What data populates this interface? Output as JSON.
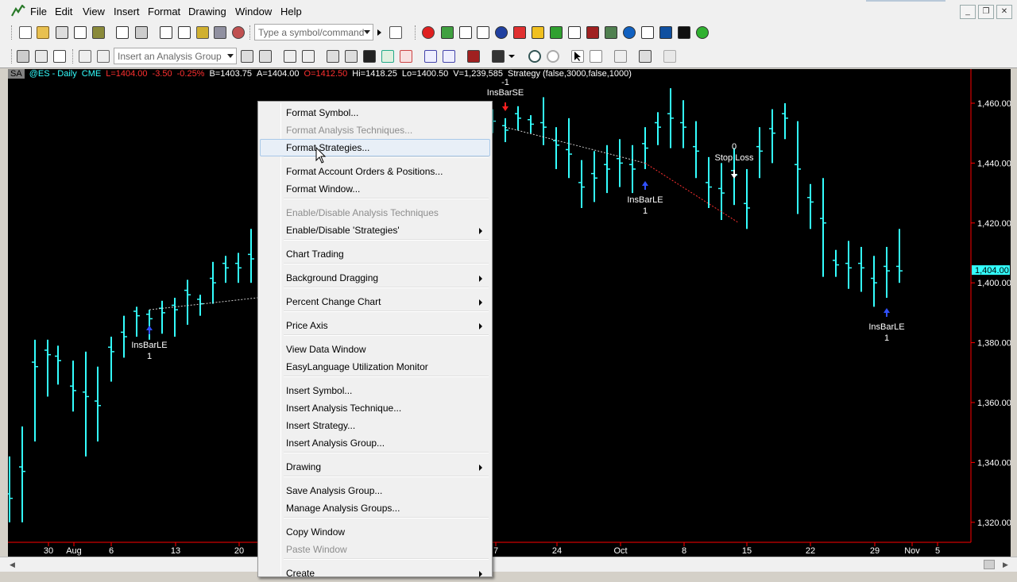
{
  "menubar": {
    "items": [
      "File",
      "Edit",
      "View",
      "Insert",
      "Format",
      "Drawing",
      "Window",
      "Help"
    ],
    "window_controls": [
      "_",
      "❐",
      "✕"
    ]
  },
  "toolbar1": {
    "symbol_combo_placeholder": "Type a symbol/command"
  },
  "toolbar2": {
    "analysis_group_placeholder": "Insert an Analysis Group"
  },
  "chart": {
    "status": {
      "sa": "SA",
      "symbol": "@ES - Daily",
      "exchange": "CME",
      "last": "L=1404.00",
      "change": "-3.50",
      "pct": "-0.25%",
      "bid": "B=1403.75",
      "ask": "A=1404.00",
      "open": "O=1412.50",
      "high": "Hi=1418.25",
      "low": "Lo=1400.50",
      "volume": "V=1,239,585",
      "strategy": "Strategy (false,3000,false,1000)"
    },
    "colors": {
      "bars": "#33ffff",
      "background": "#000000",
      "axis": "#ff0000",
      "price_tag": "#33ffff"
    },
    "price_axis": [
      "1,460.00",
      "1,440.00",
      "1,420.00",
      "1,400.00",
      "1,380.00",
      "1,360.00",
      "1,340.00",
      "1,320.00"
    ],
    "last_price_tag": "1,404.00",
    "date_axis": [
      "30",
      "Aug",
      "6",
      "13",
      "20",
      "7",
      "24",
      "Oct",
      "8",
      "15",
      "22",
      "29",
      "Nov",
      "5"
    ],
    "annotations": {
      "insbarle_a": "InsBarLE",
      "insbarle_a_qty": "1",
      "insbarse": "InsBarSE",
      "insbarse_qty": "-1",
      "insbarle_b": "InsBarLE",
      "insbarle_b_qty": "1",
      "stop_loss": "Stop Loss",
      "stop_loss_qty": "0",
      "insbarle_c": "InsBarLE",
      "insbarle_c_qty": "1"
    }
  },
  "context_menu": {
    "items": [
      {
        "label": "Format Symbol...",
        "enabled": true
      },
      {
        "label": "Format Analysis Techniques...",
        "enabled": false
      },
      {
        "label": "Format Strategies...",
        "enabled": true,
        "hover": true
      },
      {
        "label": "Format Account Orders & Positions...",
        "enabled": true
      },
      {
        "label": "Format Window...",
        "enabled": true
      },
      {
        "label": "Enable/Disable Analysis Techniques",
        "enabled": false
      },
      {
        "label": "Enable/Disable 'Strategies'",
        "enabled": true,
        "submenu": true
      },
      {
        "label": "Chart Trading",
        "enabled": true
      },
      {
        "label": "Background Dragging",
        "enabled": true,
        "submenu": true
      },
      {
        "label": "Percent Change Chart",
        "enabled": true,
        "submenu": true
      },
      {
        "label": "Price Axis",
        "enabled": true,
        "submenu": true
      },
      {
        "label": "View Data Window",
        "enabled": true
      },
      {
        "label": "EasyLanguage Utilization Monitor",
        "enabled": true
      },
      {
        "label": "Insert Symbol...",
        "enabled": true
      },
      {
        "label": "Insert Analysis Technique...",
        "enabled": true
      },
      {
        "label": "Insert Strategy...",
        "enabled": true
      },
      {
        "label": "Insert Analysis Group...",
        "enabled": true
      },
      {
        "label": "Drawing",
        "enabled": true,
        "submenu": true
      },
      {
        "label": "Save Analysis Group...",
        "enabled": true
      },
      {
        "label": "Manage Analysis Groups...",
        "enabled": true
      },
      {
        "label": "Copy Window",
        "enabled": true
      },
      {
        "label": "Paste Window",
        "enabled": false
      },
      {
        "label": "Create",
        "enabled": true,
        "submenu": true
      }
    ]
  }
}
